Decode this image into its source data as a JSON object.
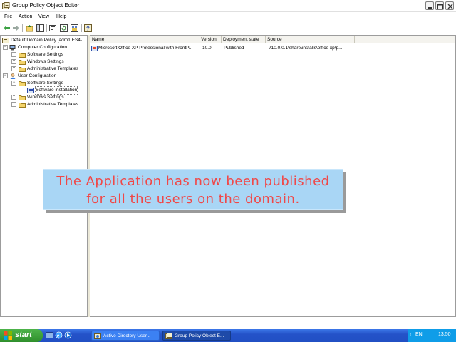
{
  "window": {
    "title": "Group Policy Object Editor",
    "controls": [
      "minimize",
      "maximize",
      "close"
    ]
  },
  "menu": {
    "items": [
      "File",
      "Action",
      "View",
      "Help"
    ]
  },
  "toolbar": {
    "buttons": [
      "back-icon",
      "forward-icon",
      "up-icon",
      "show-hide-tree-icon",
      "properties-icon",
      "refresh-icon",
      "export-list-icon",
      "help-icon"
    ]
  },
  "tree": {
    "root": "Default Domain Policy [adm1.ES4-",
    "items": [
      {
        "label": "Computer Configuration",
        "level": 1
      },
      {
        "label": "Software Settings",
        "level": 2
      },
      {
        "label": "Windows Settings",
        "level": 2
      },
      {
        "label": "Administrative Templates",
        "level": 2
      },
      {
        "label": "User Configuration",
        "level": 1
      },
      {
        "label": "Software Settings",
        "level": 2
      },
      {
        "label": "Software installation",
        "level": 3
      },
      {
        "label": "Windows Settings",
        "level": 2
      },
      {
        "label": "Administrative Templates",
        "level": 2
      }
    ]
  },
  "list": {
    "columns": [
      "Name",
      "Version",
      "Deployment state",
      "Source"
    ],
    "rows": [
      {
        "name": "Microsoft Office XP Professional with FrontP...",
        "version": "10.0",
        "state": "Published",
        "source": "\\\\10.0.0.1\\share\\installs\\office xp\\p..."
      }
    ]
  },
  "caption": {
    "line1": "The Application has now been published",
    "line2": "for all the users on the domain."
  },
  "taskbar": {
    "start_label": "start",
    "tasks": [
      "Active Directory User...",
      "Group Policy Object E..."
    ],
    "language": "EN",
    "clock": "13:50"
  },
  "colors": {
    "caption_bg": "#a9d6f5",
    "caption_text": "#f04848",
    "taskbar": "#2452c8",
    "start_button": "#3a9a37"
  }
}
